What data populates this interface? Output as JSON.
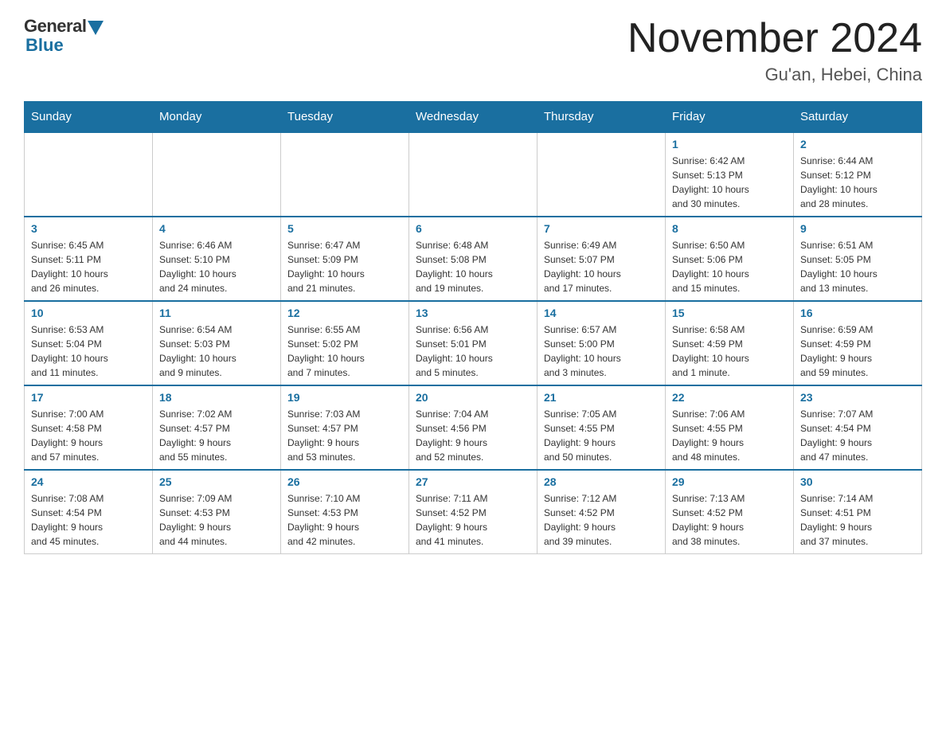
{
  "header": {
    "logo_general": "General",
    "logo_blue": "Blue",
    "month_year": "November 2024",
    "location": "Gu'an, Hebei, China"
  },
  "weekdays": [
    "Sunday",
    "Monday",
    "Tuesday",
    "Wednesday",
    "Thursday",
    "Friday",
    "Saturday"
  ],
  "weeks": [
    [
      {
        "day": "",
        "info": ""
      },
      {
        "day": "",
        "info": ""
      },
      {
        "day": "",
        "info": ""
      },
      {
        "day": "",
        "info": ""
      },
      {
        "day": "",
        "info": ""
      },
      {
        "day": "1",
        "info": "Sunrise: 6:42 AM\nSunset: 5:13 PM\nDaylight: 10 hours\nand 30 minutes."
      },
      {
        "day": "2",
        "info": "Sunrise: 6:44 AM\nSunset: 5:12 PM\nDaylight: 10 hours\nand 28 minutes."
      }
    ],
    [
      {
        "day": "3",
        "info": "Sunrise: 6:45 AM\nSunset: 5:11 PM\nDaylight: 10 hours\nand 26 minutes."
      },
      {
        "day": "4",
        "info": "Sunrise: 6:46 AM\nSunset: 5:10 PM\nDaylight: 10 hours\nand 24 minutes."
      },
      {
        "day": "5",
        "info": "Sunrise: 6:47 AM\nSunset: 5:09 PM\nDaylight: 10 hours\nand 21 minutes."
      },
      {
        "day": "6",
        "info": "Sunrise: 6:48 AM\nSunset: 5:08 PM\nDaylight: 10 hours\nand 19 minutes."
      },
      {
        "day": "7",
        "info": "Sunrise: 6:49 AM\nSunset: 5:07 PM\nDaylight: 10 hours\nand 17 minutes."
      },
      {
        "day": "8",
        "info": "Sunrise: 6:50 AM\nSunset: 5:06 PM\nDaylight: 10 hours\nand 15 minutes."
      },
      {
        "day": "9",
        "info": "Sunrise: 6:51 AM\nSunset: 5:05 PM\nDaylight: 10 hours\nand 13 minutes."
      }
    ],
    [
      {
        "day": "10",
        "info": "Sunrise: 6:53 AM\nSunset: 5:04 PM\nDaylight: 10 hours\nand 11 minutes."
      },
      {
        "day": "11",
        "info": "Sunrise: 6:54 AM\nSunset: 5:03 PM\nDaylight: 10 hours\nand 9 minutes."
      },
      {
        "day": "12",
        "info": "Sunrise: 6:55 AM\nSunset: 5:02 PM\nDaylight: 10 hours\nand 7 minutes."
      },
      {
        "day": "13",
        "info": "Sunrise: 6:56 AM\nSunset: 5:01 PM\nDaylight: 10 hours\nand 5 minutes."
      },
      {
        "day": "14",
        "info": "Sunrise: 6:57 AM\nSunset: 5:00 PM\nDaylight: 10 hours\nand 3 minutes."
      },
      {
        "day": "15",
        "info": "Sunrise: 6:58 AM\nSunset: 4:59 PM\nDaylight: 10 hours\nand 1 minute."
      },
      {
        "day": "16",
        "info": "Sunrise: 6:59 AM\nSunset: 4:59 PM\nDaylight: 9 hours\nand 59 minutes."
      }
    ],
    [
      {
        "day": "17",
        "info": "Sunrise: 7:00 AM\nSunset: 4:58 PM\nDaylight: 9 hours\nand 57 minutes."
      },
      {
        "day": "18",
        "info": "Sunrise: 7:02 AM\nSunset: 4:57 PM\nDaylight: 9 hours\nand 55 minutes."
      },
      {
        "day": "19",
        "info": "Sunrise: 7:03 AM\nSunset: 4:57 PM\nDaylight: 9 hours\nand 53 minutes."
      },
      {
        "day": "20",
        "info": "Sunrise: 7:04 AM\nSunset: 4:56 PM\nDaylight: 9 hours\nand 52 minutes."
      },
      {
        "day": "21",
        "info": "Sunrise: 7:05 AM\nSunset: 4:55 PM\nDaylight: 9 hours\nand 50 minutes."
      },
      {
        "day": "22",
        "info": "Sunrise: 7:06 AM\nSunset: 4:55 PM\nDaylight: 9 hours\nand 48 minutes."
      },
      {
        "day": "23",
        "info": "Sunrise: 7:07 AM\nSunset: 4:54 PM\nDaylight: 9 hours\nand 47 minutes."
      }
    ],
    [
      {
        "day": "24",
        "info": "Sunrise: 7:08 AM\nSunset: 4:54 PM\nDaylight: 9 hours\nand 45 minutes."
      },
      {
        "day": "25",
        "info": "Sunrise: 7:09 AM\nSunset: 4:53 PM\nDaylight: 9 hours\nand 44 minutes."
      },
      {
        "day": "26",
        "info": "Sunrise: 7:10 AM\nSunset: 4:53 PM\nDaylight: 9 hours\nand 42 minutes."
      },
      {
        "day": "27",
        "info": "Sunrise: 7:11 AM\nSunset: 4:52 PM\nDaylight: 9 hours\nand 41 minutes."
      },
      {
        "day": "28",
        "info": "Sunrise: 7:12 AM\nSunset: 4:52 PM\nDaylight: 9 hours\nand 39 minutes."
      },
      {
        "day": "29",
        "info": "Sunrise: 7:13 AM\nSunset: 4:52 PM\nDaylight: 9 hours\nand 38 minutes."
      },
      {
        "day": "30",
        "info": "Sunrise: 7:14 AM\nSunset: 4:51 PM\nDaylight: 9 hours\nand 37 minutes."
      }
    ]
  ]
}
